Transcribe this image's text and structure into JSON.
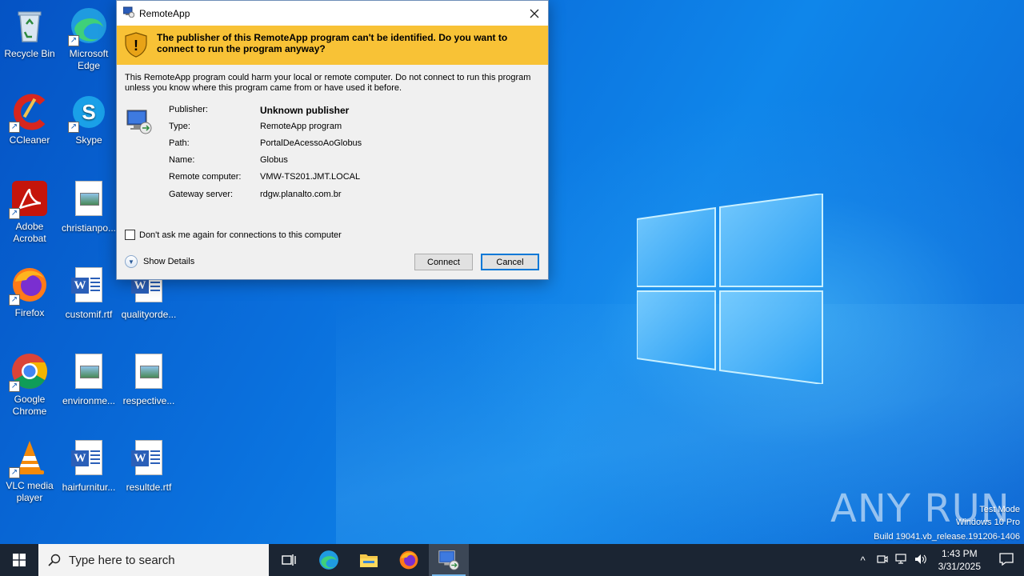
{
  "desktop": {
    "icons": [
      {
        "label": "Recycle Bin",
        "icon": "recycle-bin-icon"
      },
      {
        "label": "Microsoft Edge",
        "icon": "edge-icon"
      },
      {
        "label": "CCleaner",
        "icon": "ccleaner-icon"
      },
      {
        "label": "Skype",
        "icon": "skype-icon"
      },
      {
        "label": "Adobe Acrobat",
        "icon": "acrobat-icon"
      },
      {
        "label": "christianpo...",
        "icon": "image-file-icon"
      },
      {
        "label": "Firefox",
        "icon": "firefox-icon"
      },
      {
        "label": "customif.rtf",
        "icon": "word-doc-icon"
      },
      {
        "label": "qualityorde...",
        "icon": "word-doc-icon"
      },
      {
        "label": "Google Chrome",
        "icon": "chrome-icon"
      },
      {
        "label": "environme...",
        "icon": "image-file-icon"
      },
      {
        "label": "respective...",
        "icon": "image-file-icon"
      },
      {
        "label": "VLC media player",
        "icon": "vlc-icon"
      },
      {
        "label": "hairfurnitur...",
        "icon": "word-doc-icon"
      },
      {
        "label": "resultde.rtf",
        "icon": "word-doc-icon"
      }
    ]
  },
  "dialog": {
    "title": "RemoteApp",
    "warning": "The publisher of this RemoteApp program can't be identified. Do you want to connect to run the program anyway?",
    "description": "This RemoteApp program could harm your local or remote computer. Do not connect to run this program unless you know where this program came from or have used it before.",
    "details": [
      {
        "key": "Publisher:",
        "value": "Unknown publisher"
      },
      {
        "key": "Type:",
        "value": "RemoteApp program"
      },
      {
        "key": "Path:",
        "value": "PortalDeAcessoAoGlobus"
      },
      {
        "key": "Name:",
        "value": "Globus"
      },
      {
        "key": "Remote computer:",
        "value": "VMW-TS201.JMT.LOCAL"
      },
      {
        "key": "Gateway server:",
        "value": "rdgw.planalto.com.br"
      }
    ],
    "checkbox_label": "Don't ask me again for connections to this computer",
    "show_details": "Show Details",
    "connect": "Connect",
    "cancel": "Cancel"
  },
  "watermark": {
    "brand": "ANY RUN",
    "line1": "Test Mode",
    "line2": "Windows 10 Pro",
    "line3": "Build 19041.vb_release.191206-1406"
  },
  "taskbar": {
    "search_placeholder": "Type here to search",
    "time": "1:43 PM",
    "date": "3/31/2025"
  },
  "colors": {
    "banner": "#f8c236",
    "taskbar": "#1b2533",
    "accent": "#0078d7"
  }
}
